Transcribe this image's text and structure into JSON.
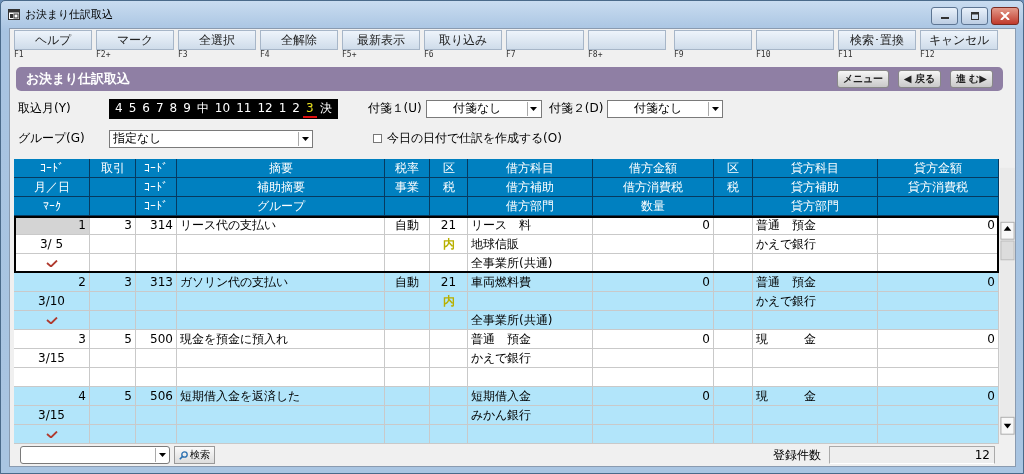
{
  "window": {
    "title": "お決まり仕訳取込"
  },
  "function_keys": [
    {
      "label": "ヘルプ",
      "key": "F1"
    },
    {
      "label": "マーク",
      "key": "F2+"
    },
    {
      "label": "全選択",
      "key": "F3"
    },
    {
      "label": "全解除",
      "key": "F4"
    },
    {
      "label": "最新表示",
      "key": "F5+"
    },
    {
      "label": "取り込み",
      "key": "F6"
    },
    {
      "key": "F7"
    },
    {
      "key": "F8+"
    },
    {
      "key": "F9"
    },
    {
      "key": "F10"
    },
    {
      "label": "検索･置換",
      "key": "F11"
    },
    {
      "label": "キャンセル",
      "key": "F12"
    }
  ],
  "header_bar": {
    "title": "お決まり仕訳取込",
    "buttons": [
      "メニュー",
      "◀ 戻る",
      "進 む▶"
    ]
  },
  "month_label": "取込月(Y)",
  "months": [
    {
      "label": "4",
      "selected": false
    },
    {
      "label": "5",
      "selected": false
    },
    {
      "label": "6",
      "selected": false
    },
    {
      "label": "7",
      "selected": false
    },
    {
      "label": "8",
      "selected": false
    },
    {
      "label": "9",
      "selected": false
    },
    {
      "label": "中",
      "selected": false
    },
    {
      "label": "10",
      "selected": false
    },
    {
      "label": "11",
      "selected": false
    },
    {
      "label": "12",
      "selected": false
    },
    {
      "label": "1",
      "selected": false
    },
    {
      "label": "2",
      "selected": false
    },
    {
      "label": "3",
      "selected": true
    },
    {
      "label": "決",
      "selected": false
    }
  ],
  "tag1": {
    "label": "付箋１(U)",
    "value": "付箋なし"
  },
  "tag2": {
    "label": "付箋２(D)",
    "value": "付箋なし"
  },
  "group": {
    "label": "グループ(G)",
    "value": "指定なし"
  },
  "today_checkbox": {
    "label": "今日の日付で仕訳を作成する(O)",
    "checked": false
  },
  "table": {
    "columns": [
      {
        "top": "ｺｰﾄﾞ",
        "middle": "月／日",
        "bottom": "ﾏｰｸ"
      },
      {
        "top": "取引"
      },
      {
        "top": "ｺｰﾄﾞ",
        "middle": "ｺｰﾄﾞ",
        "bottom": "ｺｰﾄﾞ"
      },
      {
        "top": "摘要",
        "middle": "補助摘要",
        "bottom": "グループ"
      },
      {
        "top": "税率",
        "middle": "事業"
      },
      {
        "top": "区",
        "middle": "税"
      },
      {
        "top": "借方科目",
        "middle": "借方補助",
        "bottom": "借方部門"
      },
      {
        "top": "借方金額",
        "middle": "借方消費税",
        "bottom": "数量"
      },
      {
        "top": "区",
        "middle": "税"
      },
      {
        "top": "貸方科目",
        "middle": "貸方補助",
        "bottom": "貸方部門"
      },
      {
        "top": "貸方金額",
        "middle": "貸方消費税"
      }
    ],
    "rows": [
      {
        "selected": true,
        "marked": true,
        "no": "1",
        "date": "3/ 5",
        "transaction": "3",
        "code": "314",
        "summary": "リース代の支払い",
        "tax_rate": "自動",
        "tax_code": "21",
        "tax_type": "内",
        "debit_account": "リース　料",
        "debit_sub": "地球信販",
        "debit_dept": "全事業所(共通)",
        "debit_amount": "0",
        "credit_account": "普通　預金",
        "credit_sub": "かえで銀行",
        "credit_amount": "0"
      },
      {
        "selected": false,
        "marked": true,
        "no": "2",
        "date": "3/10",
        "transaction": "3",
        "code": "313",
        "summary": "ガソリン代の支払い",
        "tax_rate": "自動",
        "tax_code": "21",
        "tax_type": "内",
        "debit_account": "車両燃料費",
        "debit_dept": "全事業所(共通)",
        "debit_amount": "0",
        "credit_account": "普通　預金",
        "credit_sub": "かえで銀行",
        "credit_amount": "0"
      },
      {
        "selected": false,
        "marked": false,
        "no": "3",
        "date": "3/15",
        "transaction": "5",
        "code": "500",
        "summary": "現金を預金に預入れ",
        "debit_account": "普通　預金",
        "debit_sub": "かえで銀行",
        "debit_amount": "0",
        "credit_account": "現　　　金",
        "credit_amount": "0"
      },
      {
        "selected": false,
        "marked": true,
        "no": "4",
        "date": "3/15",
        "transaction": "5",
        "code": "506",
        "summary": "短期借入金を返済した",
        "debit_account": "短期借入金",
        "debit_sub": "みかん銀行",
        "debit_amount": "0",
        "credit_account": "現　　　金",
        "credit_amount": "0"
      }
    ]
  },
  "search_button": "検索",
  "count": {
    "label": "登録件数",
    "value": "12"
  }
}
